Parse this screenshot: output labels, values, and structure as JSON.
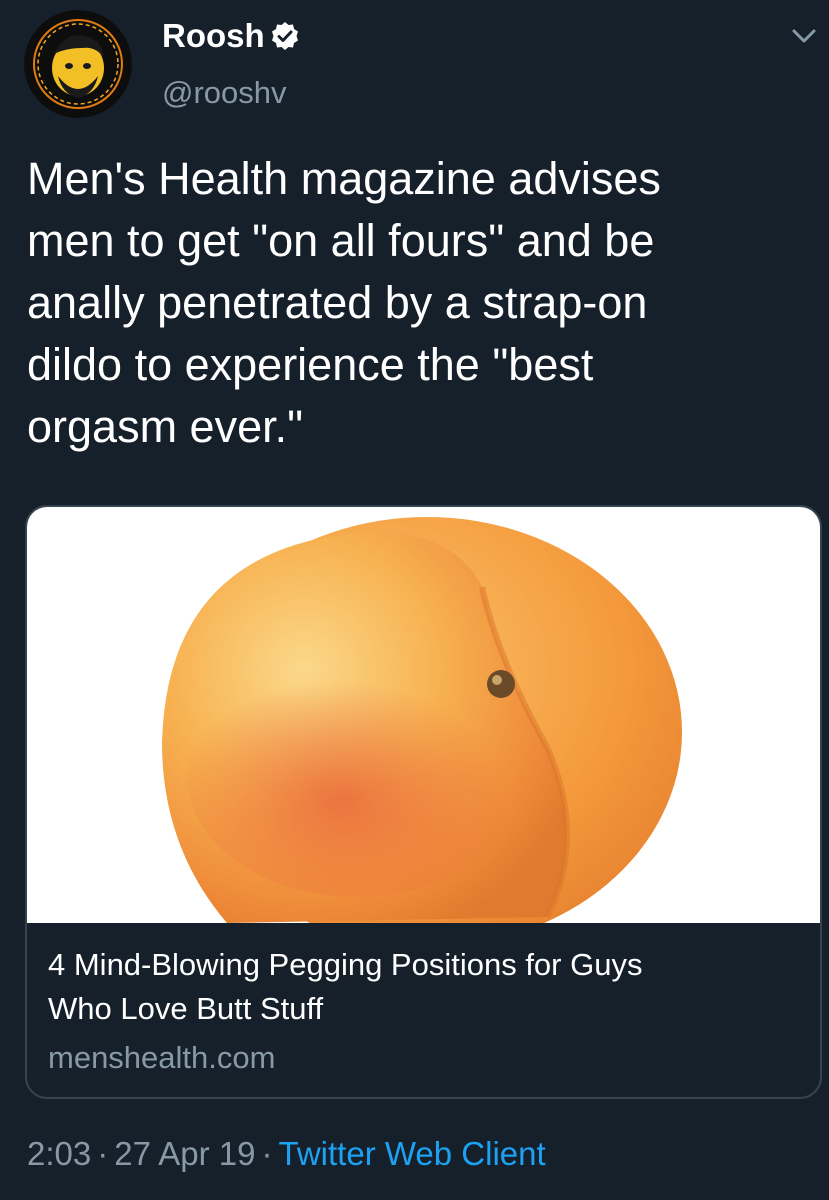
{
  "tweet": {
    "author": {
      "display_name": "Roosh",
      "handle": "@rooshv",
      "verified": true
    },
    "text": "Men's Health magazine advises\nmen to get \"on all fours\" and be\nanally penetrated by a strap-on\ndildo to experience the \"best\norgasm ever.\"",
    "card": {
      "title": "4 Mind-Blowing Pegging Positions for Guys\nWho Love Butt Stuff",
      "domain": "menshealth.com"
    },
    "time": "2:03",
    "separator": "·",
    "date": "27 Apr 19",
    "client": "Twitter Web Client"
  },
  "icons": {
    "verified": "verified-badge-icon",
    "caret": "chevron-down-icon"
  },
  "colors": {
    "background": "#15202b",
    "secondary_text": "#8899a6",
    "link": "#1da1f2",
    "border": "#38444d"
  }
}
